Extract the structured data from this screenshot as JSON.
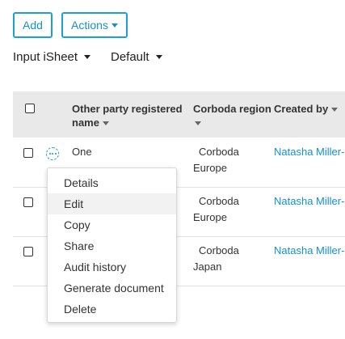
{
  "toolbar": {
    "add_label": "Add",
    "actions_label": "Actions"
  },
  "selectors": {
    "sheet": "Input iSheet",
    "view": "Default"
  },
  "table": {
    "headers": {
      "party_line1": "Other party registered",
      "party_line2": "name",
      "region": "Corboda region",
      "created_by": "Created by"
    },
    "rows": [
      {
        "name": "One",
        "region_line1": "Corboda",
        "region_line2": "Europe",
        "created_by": "Natasha Miller-"
      },
      {
        "name": "",
        "region_line1": "Corboda",
        "region_line2": "Europe",
        "created_by": "Natasha Miller-"
      },
      {
        "name": "",
        "region_line1": "Corboda",
        "region_line2": "Japan",
        "created_by": "Natasha Miller-"
      }
    ]
  },
  "context_menu": {
    "items": [
      "Details",
      "Edit",
      "Copy",
      "Share",
      "Audit history",
      "Generate document",
      "Delete"
    ],
    "active_index": 1
  },
  "colors": {
    "accent": "#1aa0d8",
    "header_bg": "#e9e9e9",
    "link": "#1592c8"
  }
}
